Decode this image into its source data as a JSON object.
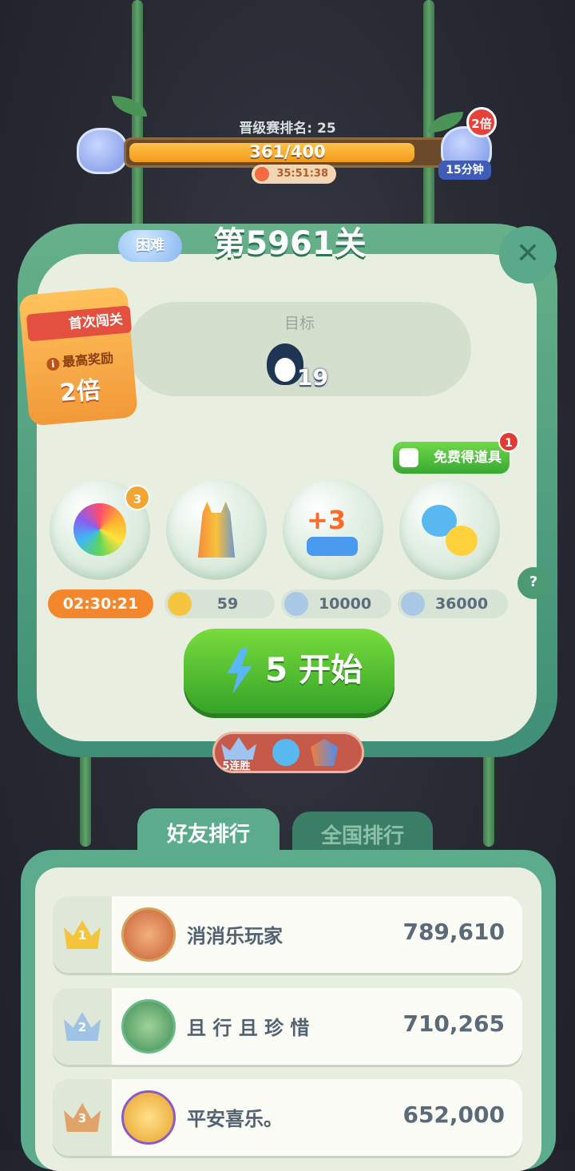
{
  "tournament": {
    "rank_text": "晋级赛排名: 25",
    "progress_text": "361/400",
    "progress_fraction": 0.9025,
    "timer": "35:51:38",
    "multiplier_badge": "2倍",
    "bonus_time": "15分钟"
  },
  "level": {
    "difficulty": "困难",
    "title": "第5961关",
    "close_icon": "close-icon"
  },
  "goal": {
    "label": "目标",
    "target_icon": "penguin-icon",
    "count": "19"
  },
  "first_clear": {
    "title": "首次闯关",
    "reward_label": "最高奖励",
    "multiplier": "2倍"
  },
  "free_items": {
    "label": "免费得道具",
    "badge": "1"
  },
  "boosters": [
    {
      "icon": "rainbow-bird-icon",
      "badge": "3",
      "price": "02:30:21"
    },
    {
      "icon": "rocket-icon",
      "price": "59"
    },
    {
      "icon": "plus-3-steps-icon",
      "price": "10000"
    },
    {
      "icon": "animal-swap-icon",
      "price": "36000"
    }
  ],
  "start": {
    "label": "5 开始"
  },
  "streak": {
    "label": "5连胜"
  },
  "leaderboard": {
    "tabs": [
      "好友排行",
      "全国排行"
    ],
    "rows": [
      {
        "rank": "1",
        "name": "消消乐玩家",
        "score": "789,610"
      },
      {
        "rank": "2",
        "name": "且 行 且 珍 惜",
        "score": "710,265"
      },
      {
        "rank": "3",
        "name": "平安喜乐。",
        "score": "652,000"
      }
    ]
  },
  "colors": {
    "gold": "#f4c43b",
    "silver": "#9fc3e4",
    "bronze": "#e0a46a"
  }
}
